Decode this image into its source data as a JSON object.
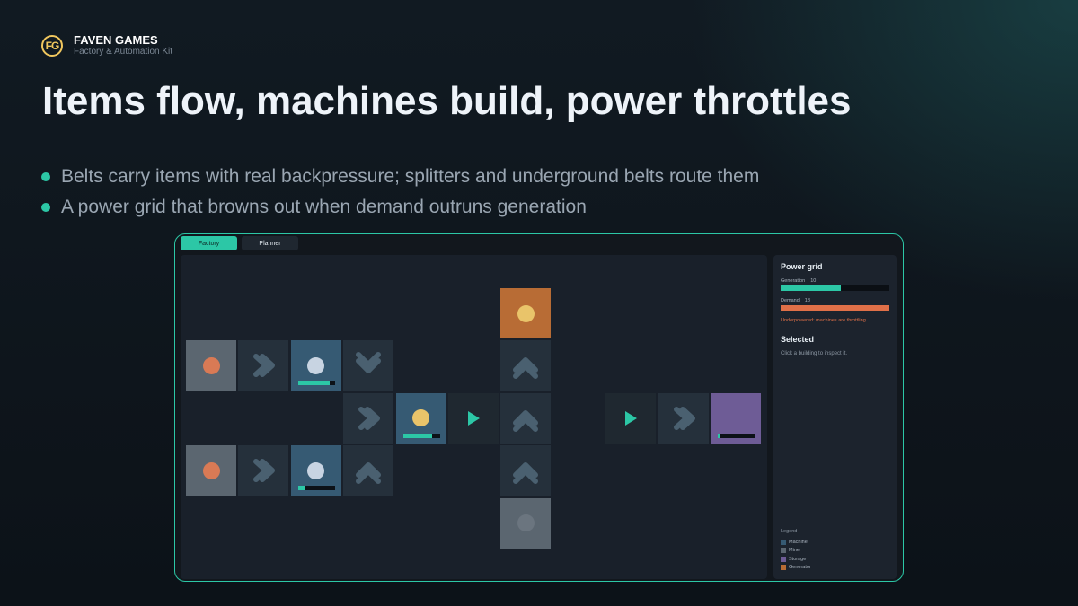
{
  "brand": {
    "logo": "FG",
    "name": "FAVEN GAMES",
    "subtitle": "Factory & Automation Kit"
  },
  "headline": "Items flow, machines build, power throttles",
  "bullets": [
    "Belts carry items with real backpressure; splitters and underground belts route them",
    "A power grid that browns out when demand outruns generation"
  ],
  "tabs": [
    {
      "label": "Factory",
      "active": true
    },
    {
      "label": "Planner",
      "active": false
    }
  ],
  "colors": {
    "accent": "#2cc7a6",
    "miner": "#5b6670",
    "machine": "#365a73",
    "storage": "#6e5c96",
    "generator": "#b86c35",
    "belt": "#25303b",
    "demand": "#e07048",
    "item_ore": "#d97a55",
    "item_plate": "#c8d4e2",
    "item_gold": "#e9c46a"
  },
  "grid": {
    "cells": [
      {
        "type": "generator",
        "icon": "generator-fuel-icon",
        "item": "gold",
        "row": 0,
        "col": 6
      },
      {
        "type": "miner",
        "icon": "ore-icon",
        "item": "ore",
        "row": 1,
        "col": 0
      },
      {
        "type": "belt",
        "icon": "belt-arrow-right-icon",
        "dir": "right",
        "row": 1,
        "col": 1
      },
      {
        "type": "machine",
        "icon": "plate-icon",
        "item": "plate",
        "progress": 0.85,
        "row": 1,
        "col": 2
      },
      {
        "type": "belt",
        "icon": "belt-arrow-down-icon",
        "dir": "down",
        "row": 1,
        "col": 3
      },
      {
        "type": "belt",
        "icon": "belt-arrow-up-icon",
        "dir": "up",
        "row": 1,
        "col": 6
      },
      {
        "type": "belt",
        "icon": "belt-arrow-right-icon",
        "dir": "right",
        "row": 2,
        "col": 3
      },
      {
        "type": "machine",
        "icon": "gear-item-icon",
        "item": "gold",
        "progress": 0.78,
        "row": 2,
        "col": 4
      },
      {
        "type": "plain",
        "icon": "inserter-arrow-icon",
        "dir": "play",
        "row": 2,
        "col": 5
      },
      {
        "type": "belt",
        "icon": "belt-arrow-up-icon",
        "dir": "up",
        "row": 2,
        "col": 6
      },
      {
        "type": "plain",
        "icon": "inserter-arrow-icon",
        "dir": "play",
        "row": 2,
        "col": 8
      },
      {
        "type": "belt",
        "icon": "belt-arrow-right-icon",
        "dir": "right",
        "row": 2,
        "col": 9
      },
      {
        "type": "storage",
        "icon": "storage-chest-icon",
        "progress": 0.05,
        "row": 2,
        "col": 10
      },
      {
        "type": "miner",
        "icon": "ore-icon",
        "item": "ore",
        "row": 3,
        "col": 0
      },
      {
        "type": "belt",
        "icon": "belt-arrow-right-icon",
        "dir": "right",
        "row": 3,
        "col": 1
      },
      {
        "type": "machine",
        "icon": "plate-icon",
        "item": "plate",
        "progress": 0.2,
        "row": 3,
        "col": 2
      },
      {
        "type": "belt",
        "icon": "belt-arrow-up-icon",
        "dir": "up",
        "row": 3,
        "col": 3
      },
      {
        "type": "belt",
        "icon": "belt-arrow-up-icon",
        "dir": "up",
        "row": 3,
        "col": 6
      },
      {
        "type": "miner",
        "icon": "depleted-ore-icon",
        "item": "none",
        "row": 4,
        "col": 6
      }
    ]
  },
  "power": {
    "title": "Power grid",
    "generation_label": "Generation",
    "generation": 10,
    "demand_label": "Demand",
    "demand": 18,
    "warning": "Underpowered: machines are throttling."
  },
  "selected": {
    "title": "Selected",
    "hint": "Click a building to inspect it."
  },
  "legend": {
    "title": "Legend",
    "items": [
      {
        "label": "Machine",
        "color": "#365a73"
      },
      {
        "label": "Miner",
        "color": "#5b6670"
      },
      {
        "label": "Storage",
        "color": "#6e5c96"
      },
      {
        "label": "Generator",
        "color": "#b86c35"
      }
    ]
  }
}
